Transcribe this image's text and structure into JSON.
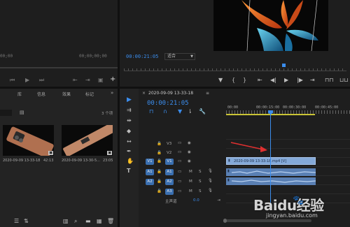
{
  "source_monitor": {
    "timecode_left": "00;00",
    "timecode_right": "00;00;00;00"
  },
  "program_monitor": {
    "timecode": "00:00:21:05",
    "fit_label": "适合"
  },
  "project_panel": {
    "tabs": [
      "",
      "库",
      "信息",
      "效果",
      "标记"
    ],
    "item_count": "3 个项",
    "clips": [
      {
        "name": "2020-09-09 13-33-18",
        "duration": "42:13"
      },
      {
        "name": "2020-09-09 13-30-5...",
        "duration": "23:05"
      }
    ]
  },
  "timeline": {
    "sequence_name": "2020-09-09 13-33-18",
    "timecode": "00:00:21:05",
    "ruler_labels": [
      "00:00",
      "00:00:15:00",
      "00:00:30:00",
      "00:00:45:00"
    ],
    "video_tracks": [
      {
        "src": "",
        "name": "V3"
      },
      {
        "src": "",
        "name": "V2"
      },
      {
        "src": "V1",
        "name": "V1"
      }
    ],
    "audio_tracks": [
      {
        "src": "A1",
        "name": "A1"
      },
      {
        "src": "A2",
        "name": "A2"
      },
      {
        "src": "",
        "name": "A3"
      }
    ],
    "master_label": "主声道",
    "master_value": "0.0",
    "video_clip_label": "2020-09-09 13-33-18.mp4 [V]",
    "track_m": "M",
    "track_s": "S"
  },
  "watermark": {
    "brand": "Baidu经验",
    "url": "jingyan.baidu.com"
  },
  "colors": {
    "accent_blue": "#3b8ded",
    "clip_video": "#84a9d8",
    "clip_audio": "#5a80b4",
    "arrow_red": "#e03030"
  }
}
